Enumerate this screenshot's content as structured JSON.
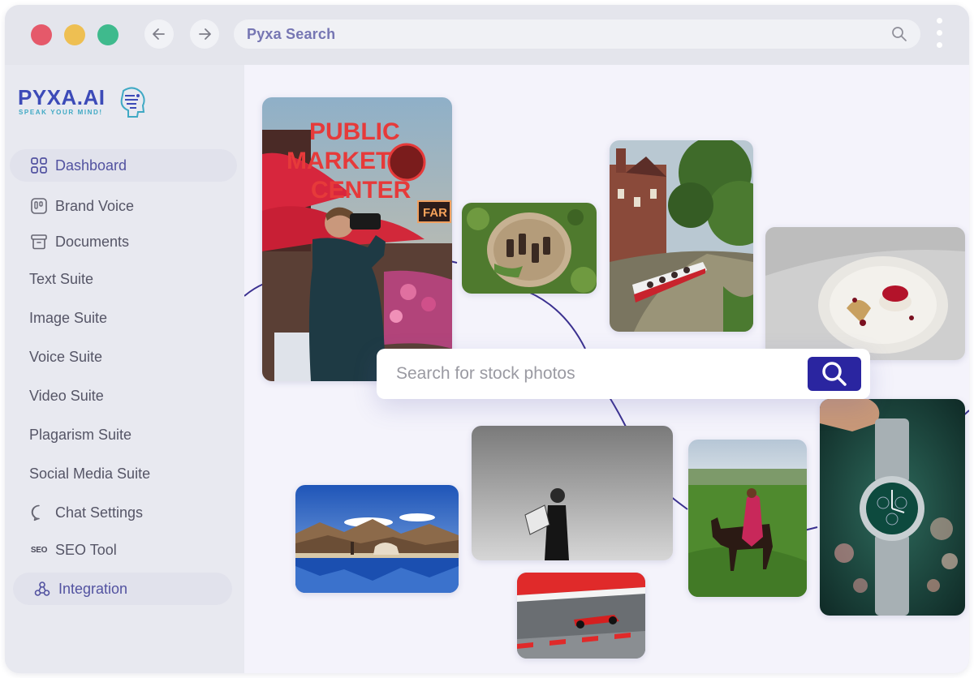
{
  "browser": {
    "url_text": "Pyxa Search"
  },
  "brand": {
    "name": "PYXA.AI",
    "tagline": "SPEAK YOUR MIND!"
  },
  "sidebar": {
    "items": [
      {
        "label": "Dashboard",
        "icon": "grid-icon",
        "active": true
      },
      {
        "label": "Brand Voice",
        "icon": "brand-voice-icon"
      },
      {
        "label": "Documents",
        "icon": "archive-icon"
      },
      {
        "label": "Text Suite"
      },
      {
        "label": "Image Suite"
      },
      {
        "label": "Voice Suite"
      },
      {
        "label": "Video Suite"
      },
      {
        "label": "Plagarism Suite"
      },
      {
        "label": "Social Media Suite"
      },
      {
        "label": "Chat Settings",
        "icon": "chat-bubble-icon"
      },
      {
        "label": "SEO Tool",
        "icon": "seo-icon",
        "icon_text": "SEO"
      },
      {
        "label": "Integration",
        "icon": "integration-icon",
        "active": true
      }
    ]
  },
  "search": {
    "placeholder": "Search for stock photos"
  },
  "photos": {
    "market_sign": "PUBLIC MARKET CENTER",
    "neon_sign": "FAR"
  },
  "colors": {
    "accent": "#2a25a0",
    "brand": "#3d4bb8",
    "active_nav_text": "#5252a0"
  }
}
